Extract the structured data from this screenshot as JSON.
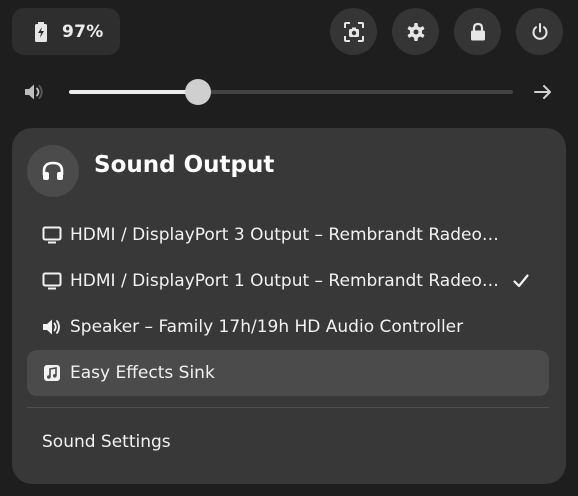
{
  "battery": {
    "label": "97%",
    "icon": "battery-charging-icon"
  },
  "quick_buttons": [
    {
      "name": "screenshot-button",
      "icon": "screenshot-icon"
    },
    {
      "name": "settings-button",
      "icon": "gear-icon"
    },
    {
      "name": "lock-button",
      "icon": "lock-icon"
    },
    {
      "name": "power-button",
      "icon": "power-icon"
    }
  ],
  "volume": {
    "icon": "speaker-volume-icon",
    "level": 0.29,
    "arrow_icon": "arrow-right-icon"
  },
  "sound_output": {
    "title": "Sound Output",
    "header_icon": "headphones-icon",
    "devices": [
      {
        "label": "HDMI / DisplayPort 3 Output – Rembrandt Radeo…",
        "icon": "monitor-icon",
        "selected": false
      },
      {
        "label": "HDMI / DisplayPort 1 Output – Rembrandt Radeon…",
        "icon": "monitor-icon",
        "selected": true
      },
      {
        "label": "Speaker – Family 17h/19h HD Audio Controller",
        "icon": "speaker-icon",
        "selected": false
      },
      {
        "label": "Easy Effects Sink",
        "icon": "music-note-icon",
        "selected": false,
        "highlighted": true
      }
    ],
    "settings_label": "Sound Settings"
  },
  "colors": {
    "background": "#1e1e1e",
    "panel": "#383838",
    "highlight": "#4b4b4b",
    "text": "#f2f2f2"
  }
}
